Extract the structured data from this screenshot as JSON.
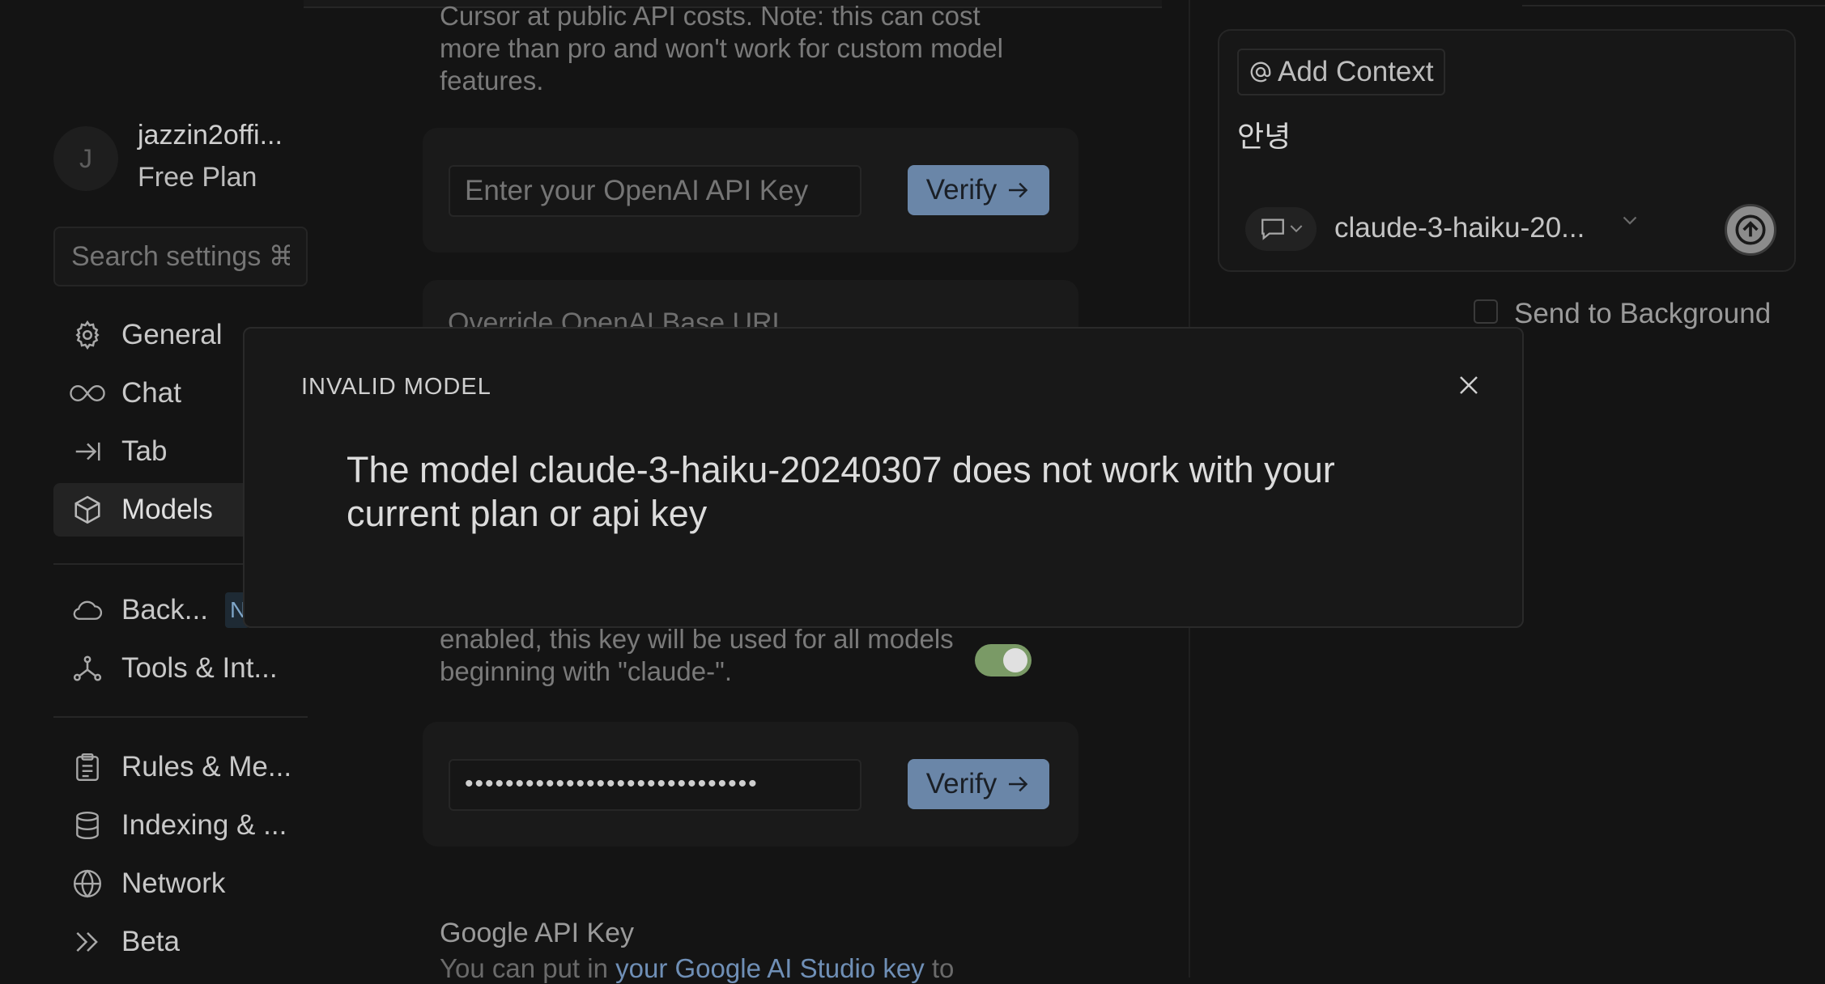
{
  "account": {
    "avatar_letter": "J",
    "name": "jazzin2offi...",
    "plan": "Free Plan"
  },
  "sidebar": {
    "search_placeholder": "Search settings ⌘F",
    "items": [
      {
        "label": "General",
        "icon": "gear-icon"
      },
      {
        "label": "Chat",
        "icon": "infinity-icon"
      },
      {
        "label": "Tab",
        "icon": "tab-arrow-icon"
      },
      {
        "label": "Models",
        "icon": "cube-icon",
        "active": true
      },
      {
        "label": "Back...",
        "icon": "cloud-icon",
        "badge": "N"
      },
      {
        "label": "Tools & Int...",
        "icon": "nodes-icon"
      },
      {
        "label": "Rules & Me...",
        "icon": "clipboard-icon"
      },
      {
        "label": "Indexing & ...",
        "icon": "database-icon"
      },
      {
        "label": "Network",
        "icon": "globe-icon"
      },
      {
        "label": "Beta",
        "icon": "chevrons-icon"
      }
    ]
  },
  "main": {
    "openai_desc_tail": "Cursor at public API costs. Note: this can cost more than pro and won't work for custom model features.",
    "openai_key_placeholder": "Enter your OpenAI API Key",
    "verify_label": "Verify",
    "override_label": "Override OpenAI Base URL",
    "anthropic_desc_tail": "enabled, this key will be used for all models beginning with \"claude-\".",
    "anthropic_toggle_on": true,
    "anthropic_key_masked": "•••••••••••••••••••••••••••••",
    "google_title": "Google API Key",
    "google_desc_prefix": "You can put in ",
    "google_desc_link": "your Google AI Studio key",
    "google_desc_suffix": " to"
  },
  "composer": {
    "add_context_label": "Add Context",
    "text": "안녕",
    "model_label": "claude-3-haiku-20...",
    "send_to_background_label": "Send to Background"
  },
  "modal": {
    "title": "INVALID MODEL",
    "message": "The model claude-3-haiku-20240307 does not work with your current plan or api key"
  },
  "colors": {
    "accent": "#6a86a8",
    "toggle": "#7a9a66",
    "background": "#141414"
  }
}
